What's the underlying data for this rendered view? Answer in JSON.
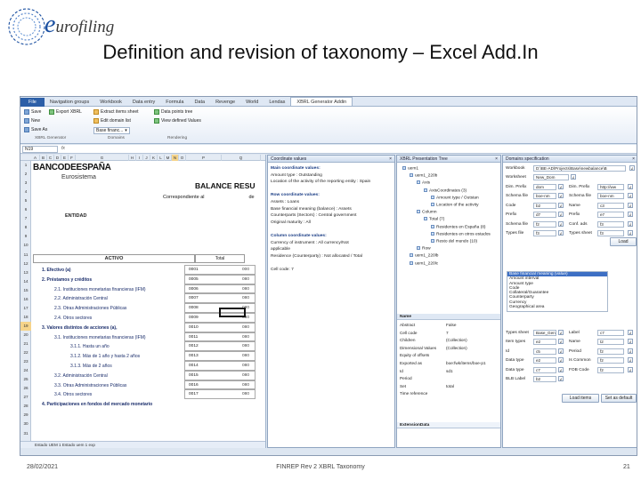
{
  "slide": {
    "title": "Definition and revision of taxonomy – Excel Add.In",
    "logo_text_e": "e",
    "logo_text_rest": "urofiling",
    "footer_date": "28/02/2021",
    "footer_center": "FINREP Rev 2 XBRL Taxonomy",
    "footer_page": "21"
  },
  "excel": {
    "tabs": [
      "File",
      "Navigation groups",
      "Workbook",
      "Data entry",
      "Formula",
      "Data",
      "Revenge",
      "World",
      "Lendas",
      "XBRL Generator Addin"
    ],
    "ribbon": {
      "save": "Save",
      "export": "Export XBRL",
      "new": "New",
      "save_as": "Save As",
      "extract_items": "Extract items sheet",
      "edit_domains": "Edit domain list",
      "base_finance": "Base financ...",
      "data_points_tree": "Data points tree",
      "defined_values": "View defined Values",
      "group_generator": "XBRL Generator",
      "group_domains": "Domains",
      "group_rendering": "Rendering"
    },
    "namebox": "N19",
    "fx": "fx",
    "columns": [
      "A",
      "B",
      "C",
      "D",
      "E",
      "F",
      "G",
      "H",
      "I",
      "J",
      "K",
      "L",
      "M",
      "N",
      "O",
      "P",
      "Q"
    ],
    "selected_column": "N",
    "row_numbers": [
      "1",
      "2",
      "3",
      "4",
      "5",
      "6",
      "7",
      "8",
      "9",
      "10",
      "11",
      "12",
      "13",
      "14",
      "15",
      "16",
      "17",
      "18",
      "19",
      "20",
      "21",
      "22",
      "23",
      "24",
      "25",
      "26",
      "27",
      "28",
      "29",
      "30",
      "31",
      "32"
    ],
    "selected_row": "19",
    "bank_name_bold": "BANCODE",
    "bank_name_rest": "ESPAÑA",
    "eurosistema": "Eurosistema",
    "balance_title": "BALANCE RESU",
    "corresponding": "Correspondiente al",
    "corresponding_de": "de",
    "entidad": "ENTIDAD",
    "activo": "ACTIVO",
    "total": "Total",
    "line_items": [
      "1. Efectivo (a)",
      "2. Préstamos y créditos",
      "2.1. Instituciones monetarias financieras (IFM)",
      "2.2. Administración Central",
      "2.3. Otras Administraciones Públicas",
      "2.4. Otros sectores",
      "3. Valores distintos de acciones (a),",
      "3.1. Instituciones monetarias financieras (IFM)",
      "3.1.1. Hasta un año",
      "3.1.2. Más de 1 año y hasta 2 años",
      "3.1.3. Más de 2 años",
      "3.2. Administración Central",
      "3.3. Otras Administraciones Públicas",
      "3.4. Otros sectores",
      "4. Participaciones en fondos del mercado monetario"
    ],
    "codes": [
      "0001",
      "0005",
      "0006",
      "0007",
      "0008",
      "0009",
      "0010",
      "0011",
      "0012",
      "0013",
      "0014",
      "0015",
      "0016",
      "0017"
    ],
    "totals_col": [
      "000",
      "080",
      "080",
      "080",
      "080",
      "080",
      "080",
      "080",
      "080",
      "080",
      "080",
      "080",
      "080",
      "080"
    ],
    "sheet_tab": "Estado UEM 1   Estado uem 1 exp"
  },
  "coordinate_pane": {
    "title": "Coordinate values",
    "close": "×",
    "lines": [
      {
        "t": "Main coordinate values:",
        "h": true
      },
      {
        "t": "Amount type : Outstanding",
        "h": false
      },
      {
        "t": "Location of the activity of the reporting entity : Spain",
        "h": false
      },
      {
        "t": "",
        "h": false
      },
      {
        "t": "Row coordinate values:",
        "h": true
      },
      {
        "t": "Assets : Loans",
        "h": false
      },
      {
        "t": "Base financial meaning (balance) : Assets",
        "h": false
      },
      {
        "t": "Counterparts (Sectors) : Central government",
        "h": false
      },
      {
        "t": "Original maturity : All",
        "h": false
      },
      {
        "t": "",
        "h": false
      },
      {
        "t": "Column coordinate values:",
        "h": true
      },
      {
        "t": "Currency of instrument : All currency/Not",
        "h": false
      },
      {
        "t": "applicable",
        "h": false
      },
      {
        "t": "Residence (Counterparty) : Not allocated / Total",
        "h": false
      },
      {
        "t": "",
        "h": false
      },
      {
        "t": "Cell code: 7",
        "h": false
      }
    ]
  },
  "presentation_pane": {
    "title": "XBRL Presentation Tree",
    "close": "×",
    "tree": [
      "uem1",
      "uem1_220b",
      "Axis",
      "AxisCoordinates (3)",
      "Amount type / Outstan",
      "Location of the activity",
      "Column",
      "Total (7)",
      "Residentes en España (8)",
      "Residentes en otros estados",
      "Resto del mundo (10)",
      "Row",
      "uem1_220lb",
      "uem1_220lc"
    ],
    "props_title": "Name",
    "props": [
      {
        "k": "Abstract",
        "v": "False"
      },
      {
        "k": "Cell code",
        "v": "7"
      },
      {
        "k": "Children",
        "v": "(Collection)"
      },
      {
        "k": "Dimensional Values",
        "v": "(Collection)"
      },
      {
        "k": "Equity of offsets",
        "v": ""
      },
      {
        "k": "Exported as",
        "v": "boe:fwk/items/boe-p1"
      },
      {
        "k": "Id",
        "v": "sd1"
      },
      {
        "k": "Period",
        "v": ""
      },
      {
        "k": "Set",
        "v": "total"
      },
      {
        "k": "Time reference",
        "v": ""
      }
    ],
    "bottom_label": "ExtensionData"
  },
  "domains_pane": {
    "title": "Domains specification",
    "close": "×",
    "workbook_label": "Workbook",
    "workbook_value": "D:\\BE-AD\\Projects\\Base\\newbalance\\B",
    "worksheet_label": "Worksheet",
    "worksheet_value": "New_Dom",
    "rows_top": [
      {
        "l1": "Dim. Prefix",
        "v1": "dom",
        "l2": "Dim. Prefix",
        "v2": "http://ww"
      },
      {
        "l1": "Schema file",
        "v1": "boe-nm",
        "l2": "Schema file",
        "v2": "boe-nm"
      },
      {
        "l1": "Code",
        "v1": "b2",
        "l2": "Name",
        "v2": "c3"
      },
      {
        "l1": "Prefix",
        "v1": "d7",
        "l2": "Prefix",
        "v2": "e7"
      },
      {
        "l1": "Schema file",
        "v1": "f2",
        "l2": "Conf. ads",
        "v2": "f3"
      },
      {
        "l1": "Types file",
        "v1": "f3",
        "l2": "Types sheet",
        "v2": "f3"
      }
    ],
    "load_button": "Load",
    "list": [
      "Base financial meaning (value)",
      "Amount interval",
      "Amount type",
      "Code",
      "Collateral/Guarantee",
      "Counterparty",
      "Currency",
      "Geographical area"
    ],
    "selected_index": 0,
    "rows_bottom": [
      {
        "l1": "Types sheet",
        "v1": "Base_Gen",
        "l2": "Label",
        "v2": "c7"
      },
      {
        "l1": "Item types",
        "v1": "e2",
        "l2": "Name",
        "v2": "t2"
      },
      {
        "l1": "Id",
        "v1": "c5",
        "l2": "Period",
        "v2": "f2"
      },
      {
        "l1": "Data type",
        "v1": "e2",
        "l2": "Is Common",
        "v2": "f2"
      },
      {
        "l1": "Data type",
        "v1": "c7",
        "l2": "FOB Code",
        "v2": "f2"
      },
      {
        "l1": "BLB Label",
        "v1": "b2",
        "l2": "",
        "v2": ""
      }
    ],
    "load_items_button": "Load items",
    "set_default_button": "Set as default"
  }
}
